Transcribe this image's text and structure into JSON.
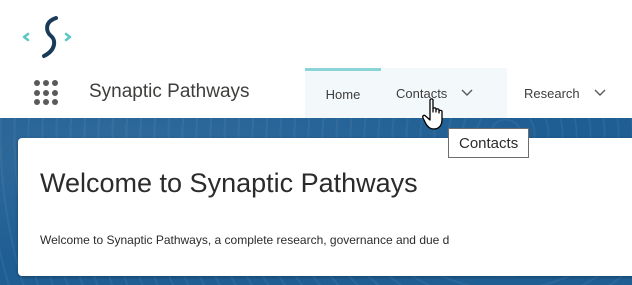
{
  "header": {
    "logo_icon": "synaptic-logo-icon"
  },
  "nav": {
    "app_launcher_icon": "app-launcher-grid-icon",
    "app_name": "Synaptic Pathways",
    "tabs": [
      {
        "label": "Home",
        "active": true
      },
      {
        "label": "Contacts",
        "has_dropdown": true,
        "icon": "chevron-down-icon"
      },
      {
        "label": "Research",
        "has_dropdown": true,
        "icon": "chevron-down-icon"
      }
    ]
  },
  "tooltip": {
    "text": "Contacts"
  },
  "welcome_card": {
    "title": "Welcome to Synaptic Pathways",
    "text": "Welcome to Synaptic Pathways, a complete research, governance and due d"
  },
  "colors": {
    "banner": "#1f5e93",
    "logo_teal": "#5cc8c2",
    "logo_dark": "#1a3a5a",
    "active_tab_accent": "#8ad4d8"
  }
}
